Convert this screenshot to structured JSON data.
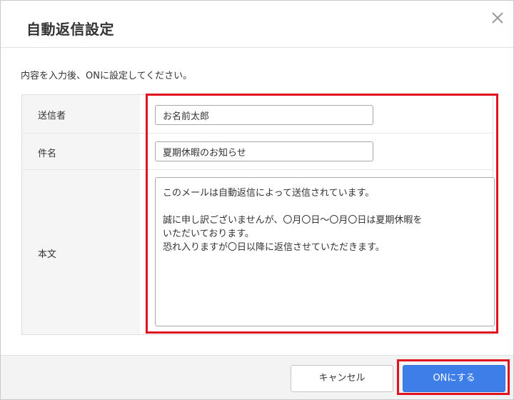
{
  "dialog": {
    "title": "自動返信設定",
    "close_icon": "close-icon",
    "instruction": "内容を入力後、ONに設定してください。"
  },
  "form": {
    "sender": {
      "label": "送信者",
      "value": "お名前太郎"
    },
    "subject": {
      "label": "件名",
      "value": "夏期休暇のお知らせ"
    },
    "body": {
      "label": "本文",
      "lines": [
        "このメールは自動返信によって送信されています。",
        "",
        "誠に申し訳ございませんが、〇月〇日～〇月〇日は夏期休暇を",
        "いただいております。",
        "恐れ入りますが〇日以降に返信させていただきます。"
      ]
    }
  },
  "footer": {
    "cancel_label": "キャンセル",
    "on_label": "ONにする"
  },
  "colors": {
    "highlight": "#e0141e",
    "primary_button": "#3d7ee8"
  }
}
